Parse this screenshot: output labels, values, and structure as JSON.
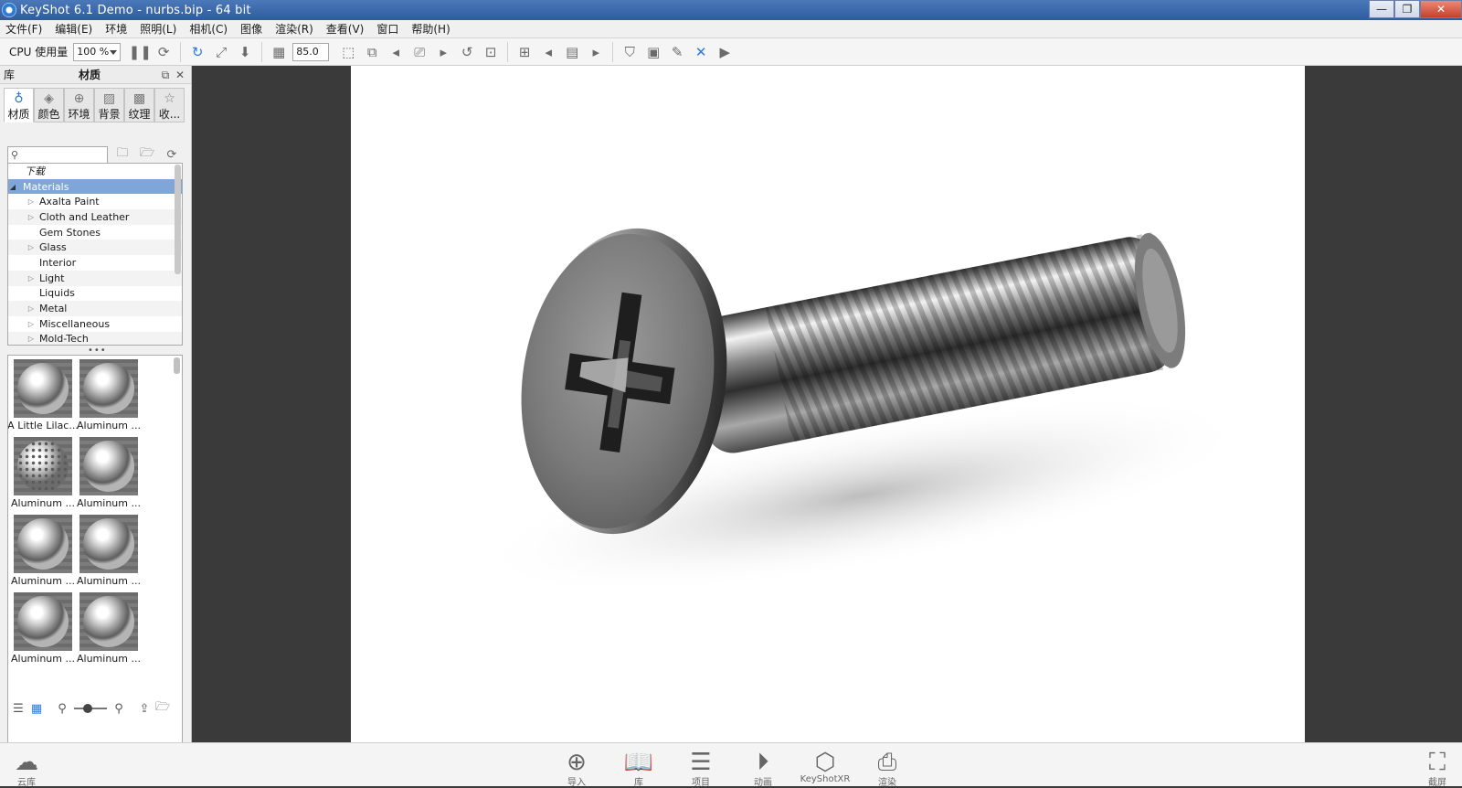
{
  "window": {
    "title": "KeyShot 6.1 Demo  - nurbs.bip  - 64 bit",
    "buttons": {
      "minimize": "—",
      "maximize": "❐",
      "close": "✕"
    }
  },
  "menu": [
    "文件(F)",
    "编辑(E)",
    "环境",
    "照明(L)",
    "相机(C)",
    "图像",
    "渲染(R)",
    "查看(V)",
    "窗口",
    "帮助(H)"
  ],
  "toolbar": {
    "cpu_label": "CPU 使用量",
    "cpu_value": "100 %",
    "fov_value": "85.0"
  },
  "library": {
    "header_left": "库",
    "header_title": "材质",
    "tabs": [
      {
        "label": "材质",
        "icon": "person-icon"
      },
      {
        "label": "颜色",
        "icon": "palette-icon"
      },
      {
        "label": "环境",
        "icon": "globe-icon"
      },
      {
        "label": "背景",
        "icon": "image-icon"
      },
      {
        "label": "纹理",
        "icon": "texture-icon"
      },
      {
        "label": "收...",
        "icon": "star-icon"
      }
    ],
    "search_placeholder": "",
    "tree": [
      {
        "label": "下载",
        "level": 1,
        "expandable": false
      },
      {
        "label": "Materials",
        "level": 0,
        "expandable": true,
        "expanded": true
      },
      {
        "label": "Axalta Paint",
        "level": 2,
        "expandable": true
      },
      {
        "label": "Cloth and Leather",
        "level": 2,
        "expandable": true
      },
      {
        "label": "Gem Stones",
        "level": 2,
        "expandable": false
      },
      {
        "label": "Glass",
        "level": 2,
        "expandable": true
      },
      {
        "label": "Interior",
        "level": 2,
        "expandable": false
      },
      {
        "label": "Light",
        "level": 2,
        "expandable": true
      },
      {
        "label": "Liquids",
        "level": 2,
        "expandable": false
      },
      {
        "label": "Metal",
        "level": 2,
        "expandable": true
      },
      {
        "label": "Miscellaneous",
        "level": 2,
        "expandable": true
      },
      {
        "label": "Mold-Tech",
        "level": 2,
        "expandable": true
      }
    ],
    "thumbnails": [
      {
        "label": "A Little Lilac...",
        "style": "normal"
      },
      {
        "label": "Aluminum ...",
        "style": "normal"
      },
      {
        "label": "Aluminum ...",
        "style": "perforated"
      },
      {
        "label": "Aluminum ...",
        "style": "normal"
      },
      {
        "label": "Aluminum ...",
        "style": "normal"
      },
      {
        "label": "Aluminum ...",
        "style": "normal"
      },
      {
        "label": "Aluminum ...",
        "style": "normal"
      },
      {
        "label": "Aluminum ...",
        "style": "normal"
      }
    ]
  },
  "bottom_bar": {
    "buttons": [
      {
        "name": "cloud-library",
        "label": "云库"
      },
      {
        "name": "import",
        "label": "导入"
      },
      {
        "name": "library",
        "label": "库"
      },
      {
        "name": "project",
        "label": "项目"
      },
      {
        "name": "animation",
        "label": "动画"
      },
      {
        "name": "keyshotxr",
        "label": "KeyShotXR"
      },
      {
        "name": "render",
        "label": "渲染"
      },
      {
        "name": "screenshot",
        "label": "截屏"
      }
    ]
  },
  "colors": {
    "accent": "#2c7ad8",
    "selection": "#7ea6d8",
    "titlebar": "#2f5c9e",
    "viewport_bg": "#3a3a3a"
  }
}
